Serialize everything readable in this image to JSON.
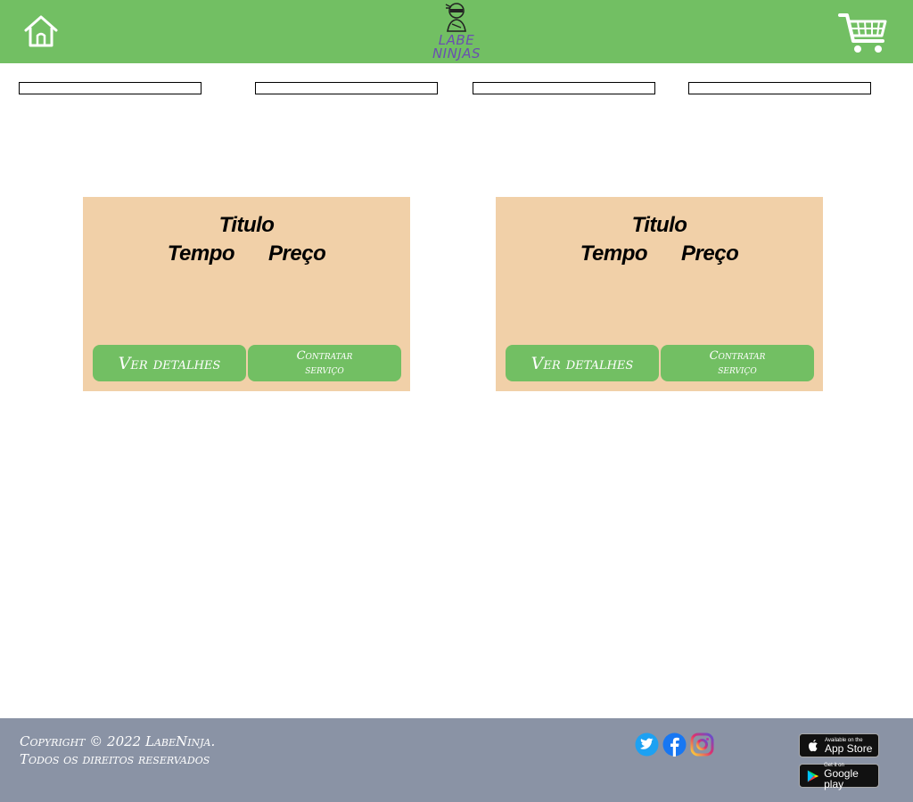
{
  "header": {
    "logo_line1": "LABE",
    "logo_line2": "NINJAS",
    "icons": [
      "home-icon",
      "cart-icon",
      "ninja-logo"
    ]
  },
  "filters": [
    {
      "value": "",
      "placeholder": ""
    },
    {
      "value": "",
      "placeholder": ""
    },
    {
      "value": "",
      "placeholder": ""
    },
    {
      "value": "",
      "placeholder": ""
    }
  ],
  "cards": [
    {
      "title": "Titulo",
      "time": "Tempo",
      "price": "Preço",
      "details_label": "Ver detalhes",
      "hire_label": "Contratar serviço"
    },
    {
      "title": "Titulo",
      "time": "Tempo",
      "price": "Preço",
      "details_label": "Ver detalhes",
      "hire_label": "Contratar serviço"
    }
  ],
  "footer": {
    "copyright_line1": "Copyright © 2022 LabeNinja.",
    "copyright_line2": "Todos os direitos reservados",
    "social_icons": [
      "twitter-icon",
      "facebook-icon",
      "instagram-icon"
    ],
    "app_store_small": "Available on the",
    "app_store_big": "App Store",
    "google_play_small": "Get it on",
    "google_play_big": "Google play"
  },
  "colors": {
    "header_bg": "#72bf63",
    "card_bg": "#f1d0a8",
    "button_bg": "#72bf63",
    "footer_bg": "#8a93a5",
    "logo_text": "#6a4fb0"
  }
}
